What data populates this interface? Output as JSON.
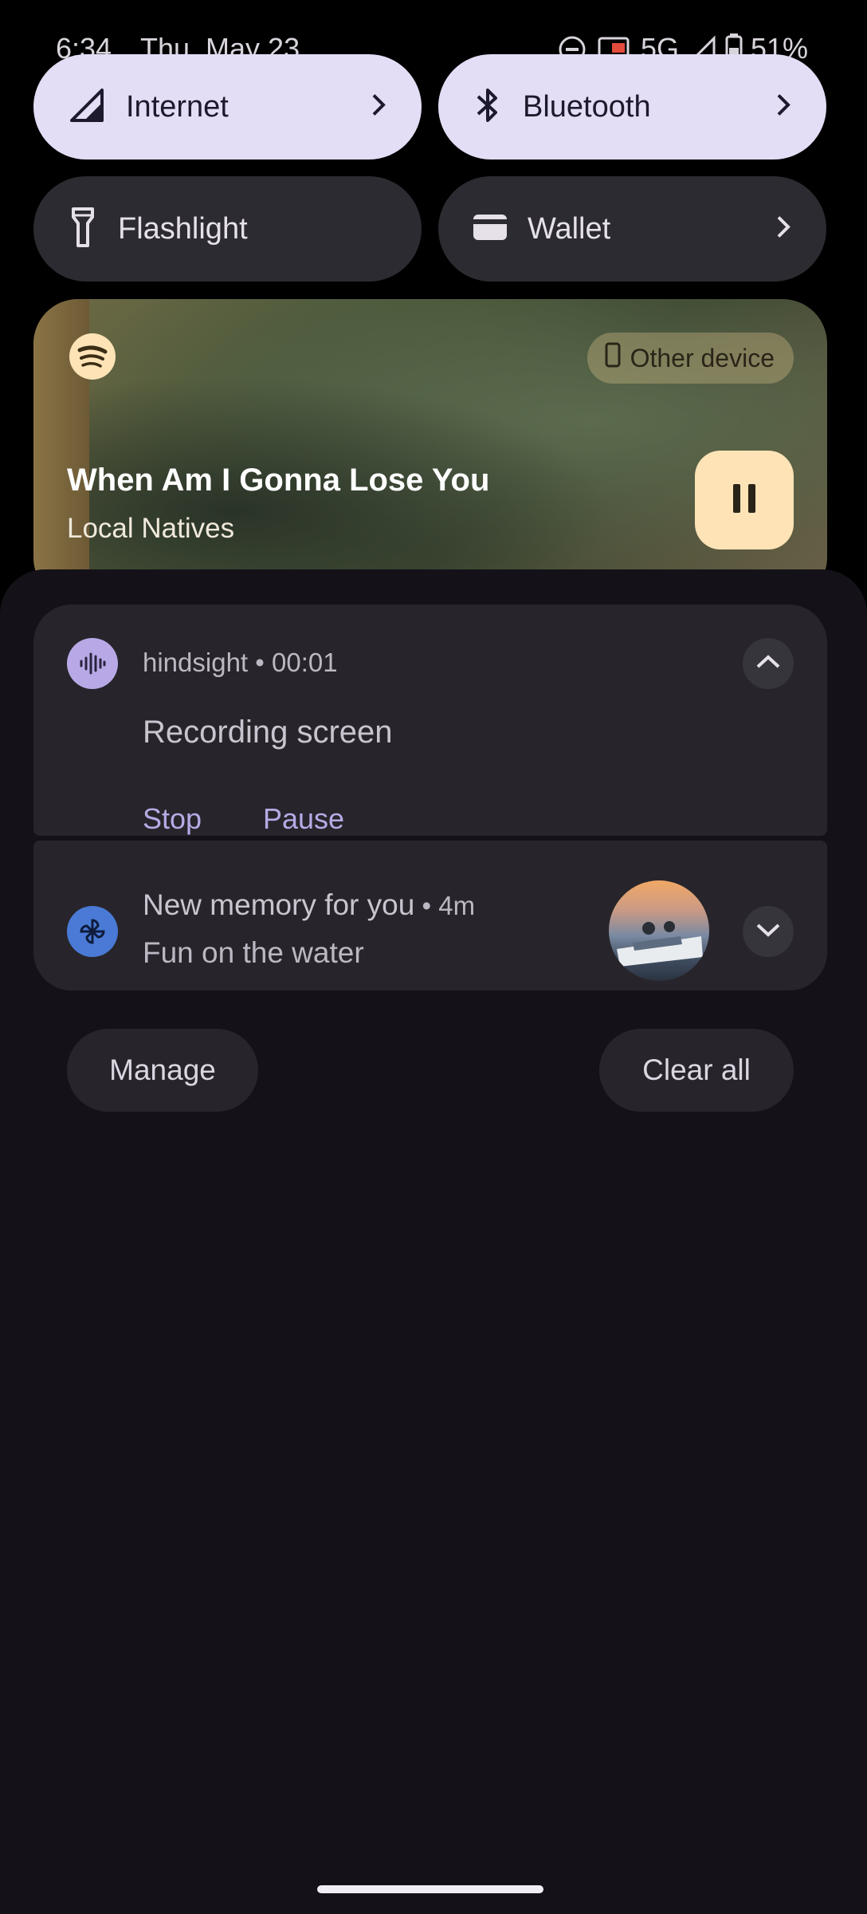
{
  "status_bar": {
    "time": "6:34",
    "date": "Thu, May 23",
    "network": "5G",
    "battery": "51%"
  },
  "quick_tiles": [
    {
      "label": "Internet",
      "icon": "signal-icon",
      "active": true,
      "has_chevron": true
    },
    {
      "label": "Bluetooth",
      "icon": "bluetooth-icon",
      "active": true,
      "has_chevron": true
    },
    {
      "label": "Flashlight",
      "icon": "flashlight-icon",
      "active": false,
      "has_chevron": false
    },
    {
      "label": "Wallet",
      "icon": "wallet-icon",
      "active": false,
      "has_chevron": true
    }
  ],
  "media": {
    "app_icon": "spotify-icon",
    "output_chip": "Other device",
    "title": "When Am I Gonna Lose You",
    "artist": "Local Natives",
    "control": "pause-icon"
  },
  "notifications": [
    {
      "app": "hindsight",
      "time": "00:01",
      "title": "Recording screen",
      "actions": [
        "Stop",
        "Pause"
      ],
      "expanded": true
    },
    {
      "title": "New memory for you",
      "time": "4m",
      "text": "Fun on the water",
      "expanded": false
    }
  ],
  "footer": {
    "manage": "Manage",
    "clear_all": "Clear all"
  },
  "colors": {
    "tile_active": "#e4ddf6",
    "tile_inactive": "#2c2b31",
    "shade_bg": "#141218",
    "accent_text": "#b8a9e6",
    "pause_button": "#fde3b6"
  }
}
